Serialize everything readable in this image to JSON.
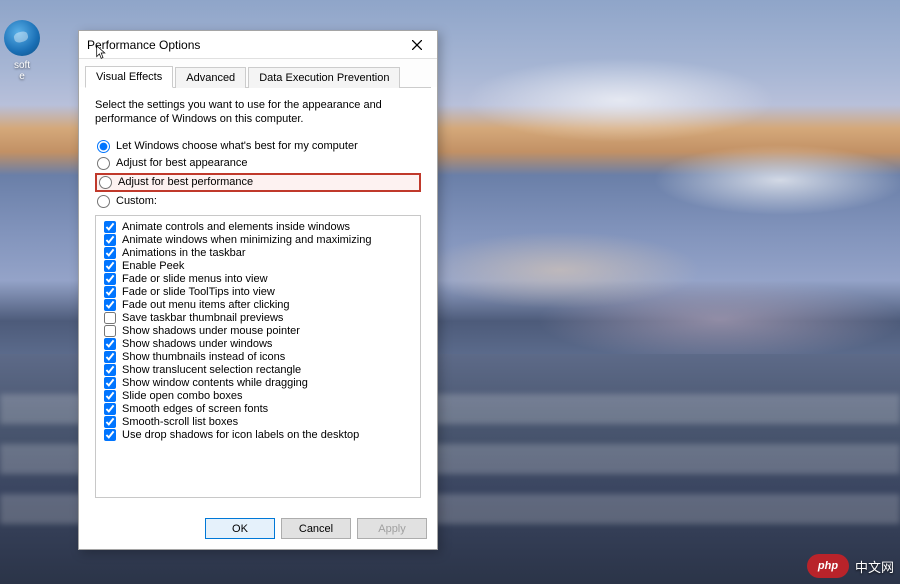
{
  "desktop": {
    "icon_label": "soft\ne"
  },
  "dialog": {
    "title": "Performance Options",
    "tabs": [
      {
        "label": "Visual Effects",
        "active": true
      },
      {
        "label": "Advanced",
        "active": false
      },
      {
        "label": "Data Execution Prevention",
        "active": false
      }
    ],
    "description": "Select the settings you want to use for the appearance and performance of Windows on this computer.",
    "radios": [
      {
        "label": "Let Windows choose what's best for my computer",
        "checked": true,
        "highlighted": false
      },
      {
        "label": "Adjust for best appearance",
        "checked": false,
        "highlighted": false
      },
      {
        "label": "Adjust for best performance",
        "checked": false,
        "highlighted": true
      },
      {
        "label": "Custom:",
        "checked": false,
        "highlighted": false
      }
    ],
    "checkboxes": [
      {
        "label": "Animate controls and elements inside windows",
        "checked": true
      },
      {
        "label": "Animate windows when minimizing and maximizing",
        "checked": true
      },
      {
        "label": "Animations in the taskbar",
        "checked": true
      },
      {
        "label": "Enable Peek",
        "checked": true
      },
      {
        "label": "Fade or slide menus into view",
        "checked": true
      },
      {
        "label": "Fade or slide ToolTips into view",
        "checked": true
      },
      {
        "label": "Fade out menu items after clicking",
        "checked": true
      },
      {
        "label": "Save taskbar thumbnail previews",
        "checked": false
      },
      {
        "label": "Show shadows under mouse pointer",
        "checked": false
      },
      {
        "label": "Show shadows under windows",
        "checked": true
      },
      {
        "label": "Show thumbnails instead of icons",
        "checked": true
      },
      {
        "label": "Show translucent selection rectangle",
        "checked": true
      },
      {
        "label": "Show window contents while dragging",
        "checked": true
      },
      {
        "label": "Slide open combo boxes",
        "checked": true
      },
      {
        "label": "Smooth edges of screen fonts",
        "checked": true
      },
      {
        "label": "Smooth-scroll list boxes",
        "checked": true
      },
      {
        "label": "Use drop shadows for icon labels on the desktop",
        "checked": true
      }
    ],
    "buttons": {
      "ok": "OK",
      "cancel": "Cancel",
      "apply": "Apply"
    }
  },
  "watermark": {
    "logo_text": "php",
    "site_text": "中文网"
  }
}
